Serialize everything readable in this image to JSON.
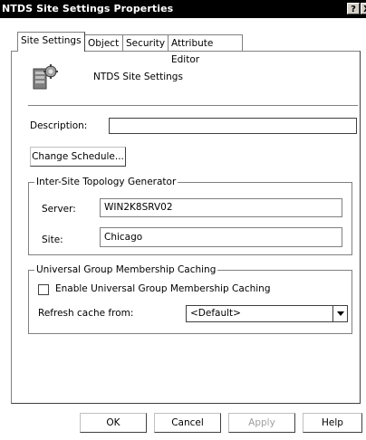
{
  "window": {
    "title": "NTDS Site Settings Properties",
    "help_button": "?",
    "close_button": "X"
  },
  "tabs": [
    {
      "label": "Site Settings",
      "active": true
    },
    {
      "label": "Object",
      "active": false
    },
    {
      "label": "Security",
      "active": false
    },
    {
      "label": "Attribute Editor",
      "active": false
    }
  ],
  "header": {
    "icon": "site-settings-icon",
    "name": "NTDS Site Settings"
  },
  "description": {
    "label": "Description:",
    "value": ""
  },
  "change_schedule_label": "Change Schedule...",
  "istg": {
    "title": "Inter-Site Topology Generator",
    "server_label": "Server:",
    "server_value": "WIN2K8SRV02",
    "site_label": "Site:",
    "site_value": "Chicago"
  },
  "ugmc": {
    "title": "Universal Group Membership Caching",
    "enable_label": "Enable Universal Group Membership Caching",
    "enable_checked": false,
    "refresh_label": "Refresh cache from:",
    "refresh_value": "<Default>"
  },
  "buttons": {
    "ok": "OK",
    "cancel": "Cancel",
    "apply": "Apply",
    "help": "Help"
  }
}
